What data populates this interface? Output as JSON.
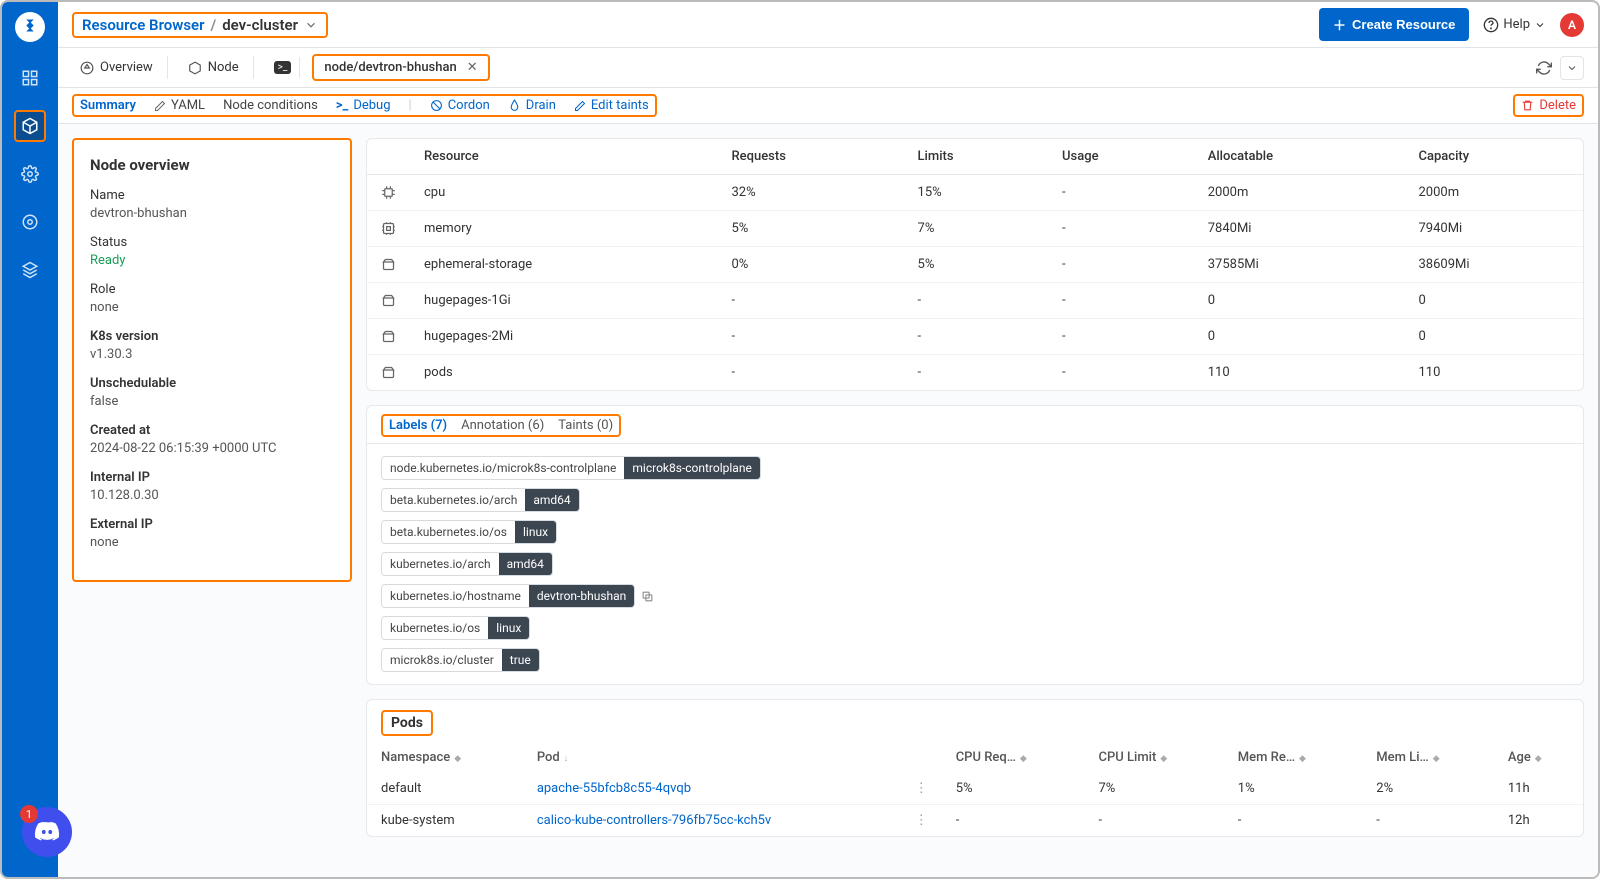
{
  "breadcrumb": {
    "root": "Resource Browser",
    "current": "dev-cluster"
  },
  "topbar": {
    "create": "Create Resource",
    "help": "Help",
    "avatar": "A"
  },
  "tabs": {
    "overview": "Overview",
    "node": "Node",
    "current": "node/devtron-bhushan"
  },
  "actions": {
    "summary": "Summary",
    "yaml": "YAML",
    "node_conditions": "Node conditions",
    "debug": "Debug",
    "cordon": "Cordon",
    "drain": "Drain",
    "edit_taints": "Edit taints",
    "delete": "Delete"
  },
  "overview": {
    "title": "Node overview",
    "fields": [
      {
        "label": "Name",
        "value": "devtron-bhushan"
      },
      {
        "label": "Status",
        "value": "Ready",
        "ready": true
      },
      {
        "label": "Role",
        "value": "none"
      },
      {
        "label": "K8s version",
        "value": "v1.30.3",
        "bold": true
      },
      {
        "label": "Unschedulable",
        "value": "false",
        "bold": true
      },
      {
        "label": "Created at",
        "value": "2024-08-22 06:15:39 +0000 UTC",
        "bold": true
      },
      {
        "label": "Internal IP",
        "value": "10.128.0.30",
        "bold": true
      },
      {
        "label": "External IP",
        "value": "none",
        "bold": true
      }
    ]
  },
  "resources": {
    "headers": [
      "Resource",
      "Requests",
      "Limits",
      "Usage",
      "Allocatable",
      "Capacity"
    ],
    "rows": [
      {
        "icon": "cpu",
        "name": "cpu",
        "requests": "32%",
        "limits": "15%",
        "usage": "-",
        "allocatable": "2000m",
        "capacity": "2000m"
      },
      {
        "icon": "memory",
        "name": "memory",
        "requests": "5%",
        "limits": "7%",
        "usage": "-",
        "allocatable": "7840Mi",
        "capacity": "7940Mi"
      },
      {
        "icon": "storage",
        "name": "ephemeral-storage",
        "requests": "0%",
        "limits": "5%",
        "usage": "-",
        "allocatable": "37585Mi",
        "capacity": "38609Mi"
      },
      {
        "icon": "storage",
        "name": "hugepages-1Gi",
        "requests": "-",
        "limits": "-",
        "usage": "-",
        "allocatable": "0",
        "capacity": "0"
      },
      {
        "icon": "storage",
        "name": "hugepages-2Mi",
        "requests": "-",
        "limits": "-",
        "usage": "-",
        "allocatable": "0",
        "capacity": "0"
      },
      {
        "icon": "storage",
        "name": "pods",
        "requests": "-",
        "limits": "-",
        "usage": "-",
        "allocatable": "110",
        "capacity": "110"
      }
    ]
  },
  "labels_tabs": {
    "labels": "Labels (7)",
    "annotation": "Annotation (6)",
    "taints": "Taints (0)"
  },
  "labels": [
    {
      "k": "node.kubernetes.io/microk8s-controlplane",
      "v": "microk8s-controlplane"
    },
    {
      "k": "beta.kubernetes.io/arch",
      "v": "amd64"
    },
    {
      "k": "beta.kubernetes.io/os",
      "v": "linux"
    },
    {
      "k": "kubernetes.io/arch",
      "v": "amd64"
    },
    {
      "k": "kubernetes.io/hostname",
      "v": "devtron-bhushan",
      "copy": true
    },
    {
      "k": "kubernetes.io/os",
      "v": "linux"
    },
    {
      "k": "microk8s.io/cluster",
      "v": "true"
    }
  ],
  "pods": {
    "title": "Pods",
    "headers": {
      "ns": "Namespace",
      "pod": "Pod",
      "cpu_req": "CPU Req…",
      "cpu_lim": "CPU Limit",
      "mem_req": "Mem Re…",
      "mem_lim": "Mem Li…",
      "age": "Age"
    },
    "rows": [
      {
        "ns": "default",
        "pod": "apache-55bfcb8c55-4qvqb",
        "cpu_req": "5%",
        "cpu_lim": "7%",
        "mem_req": "1%",
        "mem_lim": "2%",
        "age": "11h"
      },
      {
        "ns": "kube-system",
        "pod": "calico-kube-controllers-796fb75cc-kch5v",
        "cpu_req": "-",
        "cpu_lim": "-",
        "mem_req": "-",
        "mem_lim": "-",
        "age": "12h"
      }
    ]
  },
  "discord_count": "1"
}
